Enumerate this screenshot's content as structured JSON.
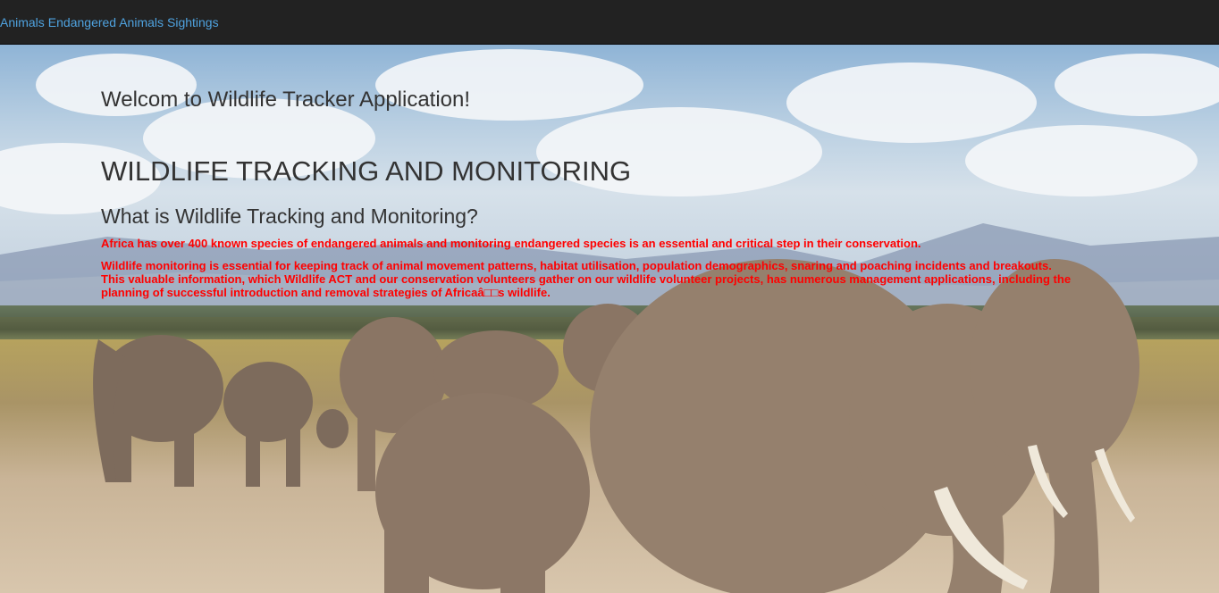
{
  "navbar": {
    "links": [
      {
        "label": "Animals"
      },
      {
        "label": "Endangered Animals"
      },
      {
        "label": "Sightings"
      }
    ]
  },
  "main": {
    "welcome": "Welcom to Wildlife Tracker Application!",
    "title": "WILDLIFE TRACKING AND MONITORING",
    "subtitle": "What is Wildlife Tracking and Monitoring?",
    "paragraph1": "Africa has over 400 known species of endangered animals and monitoring endangered species is an essential and critical step in their conservation.",
    "paragraph2": "Wildlife monitoring is essential for keeping track of animal movement patterns, habitat utilisation, population demographics, snaring and poaching incidents and breakouts. This valuable information, which Wildlife ACT and our conservation volunteers gather on our wildlife volunteer projects, has numerous management applications, including the planning of successful introduction and removal strategies of Africaâ□□s wildlife."
  },
  "colors": {
    "navbar_bg": "#222222",
    "nav_link": "#4fa3e0",
    "heading_text": "#333333",
    "paragraph_text": "#ff0000"
  },
  "background_image": "elephant-herd-savanna"
}
